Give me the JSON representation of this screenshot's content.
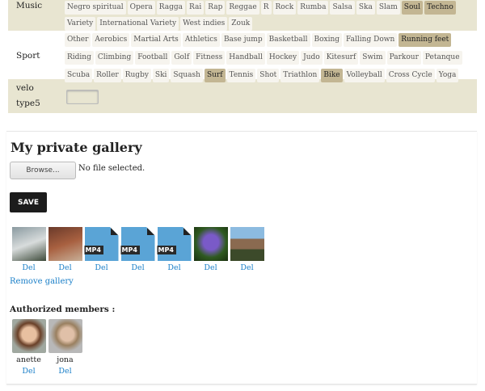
{
  "categories": [
    {
      "label": "Music",
      "tags": [
        {
          "t": "Negro spiritual"
        },
        {
          "t": "Opera"
        },
        {
          "t": "Ragga"
        },
        {
          "t": "Rai"
        },
        {
          "t": "Rap"
        },
        {
          "t": "Reggae"
        },
        {
          "t": "R"
        },
        {
          "t": "Rock"
        },
        {
          "t": "Rumba"
        },
        {
          "t": "Salsa"
        },
        {
          "t": "Ska"
        },
        {
          "t": "Slam"
        },
        {
          "t": "Soul",
          "s": true
        },
        {
          "t": "Techno",
          "s": true
        },
        {
          "t": "Variety"
        },
        {
          "t": "International Variety"
        },
        {
          "t": "West indies"
        },
        {
          "t": "Zouk"
        }
      ]
    },
    {
      "label": "Sport",
      "tags": [
        {
          "t": "Other"
        },
        {
          "t": "Aerobics"
        },
        {
          "t": "Martial Arts"
        },
        {
          "t": "Athletics"
        },
        {
          "t": "Base jump"
        },
        {
          "t": "Basketball"
        },
        {
          "t": "Boxing"
        },
        {
          "t": "Falling Down"
        },
        {
          "t": "Running feet",
          "s": true
        },
        {
          "t": "Riding"
        },
        {
          "t": "Climbing"
        },
        {
          "t": "Football"
        },
        {
          "t": "Golf"
        },
        {
          "t": "Fitness"
        },
        {
          "t": "Handball"
        },
        {
          "t": "Hockey"
        },
        {
          "t": "Judo"
        },
        {
          "t": "Kitesurf"
        },
        {
          "t": "Swim"
        },
        {
          "t": "Parkour"
        },
        {
          "t": "Petanque"
        },
        {
          "t": "Scuba"
        },
        {
          "t": "Roller"
        },
        {
          "t": "Rugby"
        },
        {
          "t": "Ski"
        },
        {
          "t": "Squash"
        },
        {
          "t": "Surf",
          "s": true
        },
        {
          "t": "Tennis"
        },
        {
          "t": "Shot"
        },
        {
          "t": "Triathlon"
        },
        {
          "t": "Bike",
          "s": true
        },
        {
          "t": "Volleyball"
        },
        {
          "t": "Cross Cycle"
        },
        {
          "t": "Yoga"
        }
      ]
    }
  ],
  "velo": {
    "label1": "velo",
    "label2": "type5",
    "value": ""
  },
  "gallery": {
    "title": "My private gallery",
    "browse": "Browse...",
    "no_file": "No file selected.",
    "save": "SAVE",
    "del": "Del",
    "remove": "Remove gallery",
    "mp4": "MP4",
    "items": [
      {
        "type": "image",
        "desc": "snowy path"
      },
      {
        "type": "image",
        "desc": "castle ruin"
      },
      {
        "type": "mp4"
      },
      {
        "type": "mp4"
      },
      {
        "type": "mp4"
      },
      {
        "type": "image",
        "desc": "iris flower"
      },
      {
        "type": "image",
        "desc": "castle"
      }
    ]
  },
  "members": {
    "title": "Authorized members :",
    "list": [
      {
        "name": "anette"
      },
      {
        "name": "jona"
      }
    ]
  },
  "colors": {
    "selected_tag": "#c3b693",
    "row_beige": "#e8e5d1",
    "link": "#1a7fc8"
  }
}
